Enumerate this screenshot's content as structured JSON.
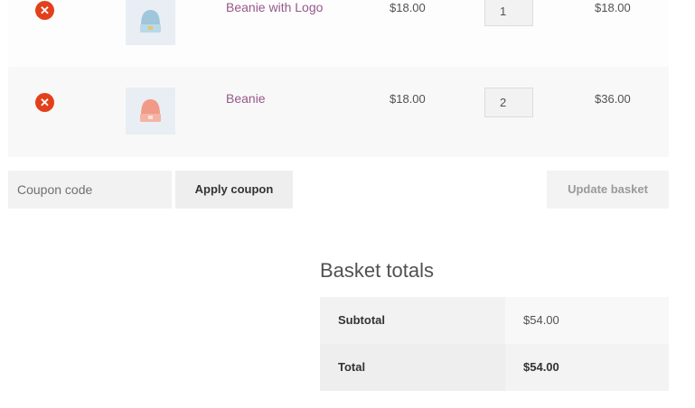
{
  "cart": {
    "items": [
      {
        "name": "Beanie with Logo",
        "price": "$18.00",
        "quantity": "1",
        "subtotal": "$18.00",
        "remove_icon": "close-circle-icon",
        "thumb_color": "#9fc6db"
      },
      {
        "name": "Beanie",
        "price": "$18.00",
        "quantity": "2",
        "subtotal": "$36.00",
        "remove_icon": "close-circle-icon",
        "thumb_color": "#f09a87"
      }
    ]
  },
  "coupon": {
    "placeholder": "Coupon code",
    "apply_label": "Apply coupon"
  },
  "update_label": "Update basket",
  "totals": {
    "title": "Basket totals",
    "subtotal_label": "Subtotal",
    "subtotal_value": "$54.00",
    "total_label": "Total",
    "total_value": "$54.00"
  },
  "colors": {
    "remove": "#e2401c",
    "link": "#96588a"
  }
}
